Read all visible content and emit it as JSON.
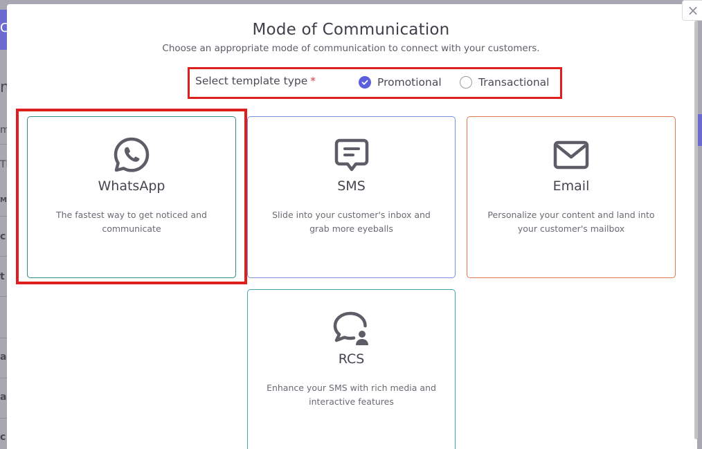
{
  "modal": {
    "title": "Mode of Communication",
    "subtitle": "Choose an appropriate mode of communication to connect with your customers.",
    "close_symbol": "×"
  },
  "template_type": {
    "label": "Select template type",
    "required_mark": "*",
    "options": [
      {
        "label": "Promotional",
        "selected": true
      },
      {
        "label": "Transactional",
        "selected": false
      }
    ]
  },
  "channels": [
    {
      "title": "WhatsApp",
      "description": "The fastest way to get noticed and communicate",
      "icon": "whatsapp-icon",
      "border_color": "#2e8b84"
    },
    {
      "title": "SMS",
      "description": "Slide into your customer's inbox and grab more eyeballs",
      "icon": "sms-icon",
      "border_color": "#7c8fe0"
    },
    {
      "title": "Email",
      "description": "Personalize your content and land into your customer's mailbox",
      "icon": "email-icon",
      "border_color": "#e0774f"
    },
    {
      "title": "RCS",
      "description": "Enhance your SMS with rich media and interactive features",
      "icon": "rcs-icon",
      "border_color": "#3fa3b0"
    }
  ],
  "background_fragments": [
    "C",
    "m",
    "m",
    "Th",
    "MF",
    "c",
    "t",
    "a",
    "a",
    "c"
  ],
  "colors": {
    "accent": "#5b5fde",
    "highlight": "#e01e1e",
    "icon": "#5d5d68"
  }
}
